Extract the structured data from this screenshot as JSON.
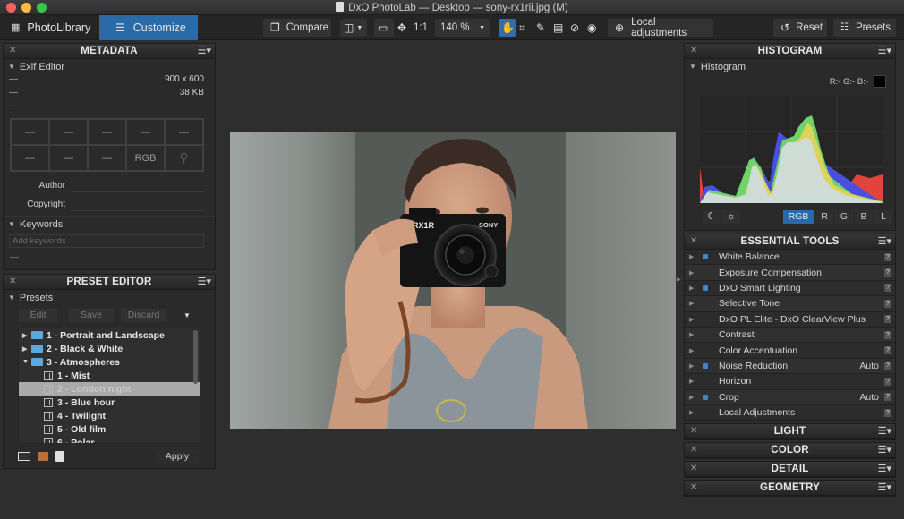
{
  "window": {
    "title": "DxO PhotoLab — Desktop — sony-rx1rii.jpg (M)",
    "traffic_colors": [
      "#fc605c",
      "#fdbc40",
      "#34c84a"
    ]
  },
  "toolbar": {
    "tabs": [
      {
        "label": "PhotoLibrary",
        "icon": "grid-icon",
        "active": false
      },
      {
        "label": "Customize",
        "icon": "sliders-icon",
        "active": true
      }
    ],
    "compare_label": "Compare",
    "one_to_one_label": "1:1",
    "zoom_value": "140 %",
    "local_adjustments_label": "Local adjustments",
    "reset_label": "Reset",
    "presets_label": "Presets",
    "tools": [
      "hand-icon",
      "crop-icon",
      "eyedropper-icon",
      "horizon-icon",
      "repair-icon",
      "eye-icon"
    ],
    "active_tool": "hand-icon",
    "accent": "#2b6aa8"
  },
  "metadata": {
    "title": "METADATA",
    "exif_section": "Exif Editor",
    "rows": [
      {
        "key": "—",
        "value": "900 x 600"
      },
      {
        "key": "—",
        "value": "38 KB"
      },
      {
        "key": "—",
        "value": ""
      }
    ],
    "grid": [
      "—",
      "—",
      "—",
      "—",
      "—",
      "—",
      "—",
      "—",
      "RGB",
      "location-pin"
    ],
    "author_label": "Author",
    "author_value": "",
    "copyright_label": "Copyright",
    "copyright_value": "",
    "keywords_section": "Keywords",
    "keywords_placeholder": "Add keywords",
    "keywords_footer": "—"
  },
  "preset_editor": {
    "title": "PRESET EDITOR",
    "section": "Presets",
    "buttons": {
      "edit": "Edit",
      "save": "Save",
      "discard": "Discard"
    },
    "tree": [
      {
        "label": "1 - Portrait and Landscape",
        "type": "folder",
        "expanded": false,
        "level": 0
      },
      {
        "label": "2 - Black & White",
        "type": "folder",
        "expanded": false,
        "level": 0
      },
      {
        "label": "3 - Atmospheres",
        "type": "folder",
        "expanded": true,
        "level": 0
      },
      {
        "label": "1 - Mist",
        "type": "preset",
        "level": 1
      },
      {
        "label": "2 - London night",
        "type": "preset",
        "level": 1,
        "selected": true
      },
      {
        "label": "3 - Blue hour",
        "type": "preset",
        "level": 1
      },
      {
        "label": "4 - Twilight",
        "type": "preset",
        "level": 1
      },
      {
        "label": "5 - Old film",
        "type": "preset",
        "level": 1
      },
      {
        "label": "6 - Polar",
        "type": "preset",
        "level": 1
      }
    ],
    "apply_label": "Apply"
  },
  "histogram": {
    "title": "HISTOGRAM",
    "section": "Histogram",
    "readout": "R:- G:- B:-",
    "channels": [
      "RGB",
      "R",
      "G",
      "B",
      "L"
    ],
    "active_channel": "RGB"
  },
  "essential_tools": {
    "title": "ESSENTIAL TOOLS",
    "items": [
      {
        "label": "White Balance",
        "enabled": true,
        "value": ""
      },
      {
        "label": "Exposure Compensation",
        "enabled": false,
        "value": ""
      },
      {
        "label": "DxO Smart Lighting",
        "enabled": true,
        "value": ""
      },
      {
        "label": "Selective Tone",
        "enabled": false,
        "value": ""
      },
      {
        "label": "DxO PL Elite - DxO ClearView Plus",
        "enabled": false,
        "value": ""
      },
      {
        "label": "Contrast",
        "enabled": false,
        "value": ""
      },
      {
        "label": "Color Accentuation",
        "enabled": false,
        "value": ""
      },
      {
        "label": "Noise Reduction",
        "enabled": true,
        "value": "Auto"
      },
      {
        "label": "Horizon",
        "enabled": false,
        "value": ""
      },
      {
        "label": "Crop",
        "enabled": true,
        "value": "Auto"
      },
      {
        "label": "Local Adjustments",
        "enabled": false,
        "value": ""
      }
    ],
    "help_glyph": "?"
  },
  "collapsed_panels": [
    "LIGHT",
    "COLOR",
    "DETAIL",
    "GEOMETRY"
  ],
  "photo": {
    "description": "Man holding Sony RX1R II camera",
    "camera_brand": "SONY",
    "camera_model": "RX1R"
  }
}
